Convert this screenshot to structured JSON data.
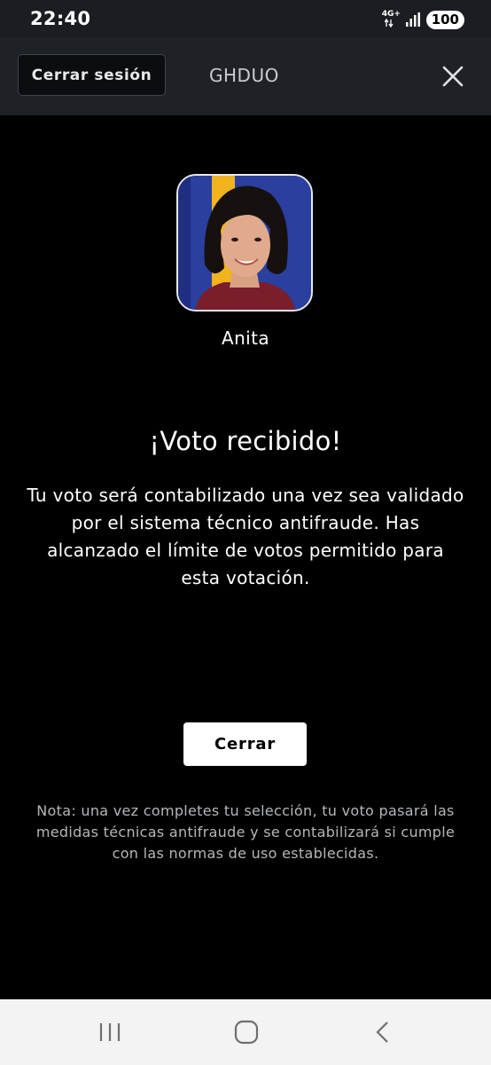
{
  "status_bar": {
    "time": "22:40",
    "network": "4G+",
    "battery": "100"
  },
  "header": {
    "logout_label": "Cerrar sesión",
    "title": "GHDUO",
    "close_icon": "close-icon"
  },
  "contestant": {
    "name": "Anita"
  },
  "result": {
    "title": "¡Voto recibido!",
    "message": "Tu voto será contabilizado una vez sea validado por el sistema técnico antifraude. Has alcanzado el límite de votos permitido para esta votación."
  },
  "actions": {
    "close_label": "Cerrar"
  },
  "note": "Nota: una vez completes tu selección, tu voto pasará las medidas técnicas antifraude y se contabilizará si cumple con las normas de uso establecidas.",
  "nav": {
    "recents_icon": "recent-apps-icon",
    "home_icon": "home-icon",
    "back_icon": "back-icon"
  },
  "colors": {
    "background": "#000000",
    "header": "#1e2227",
    "status_bar": "#1a1d21",
    "avatar_bg": "#2a3f9e",
    "avatar_stripe": "#f0b41e",
    "primary_button": "#ffffff"
  }
}
